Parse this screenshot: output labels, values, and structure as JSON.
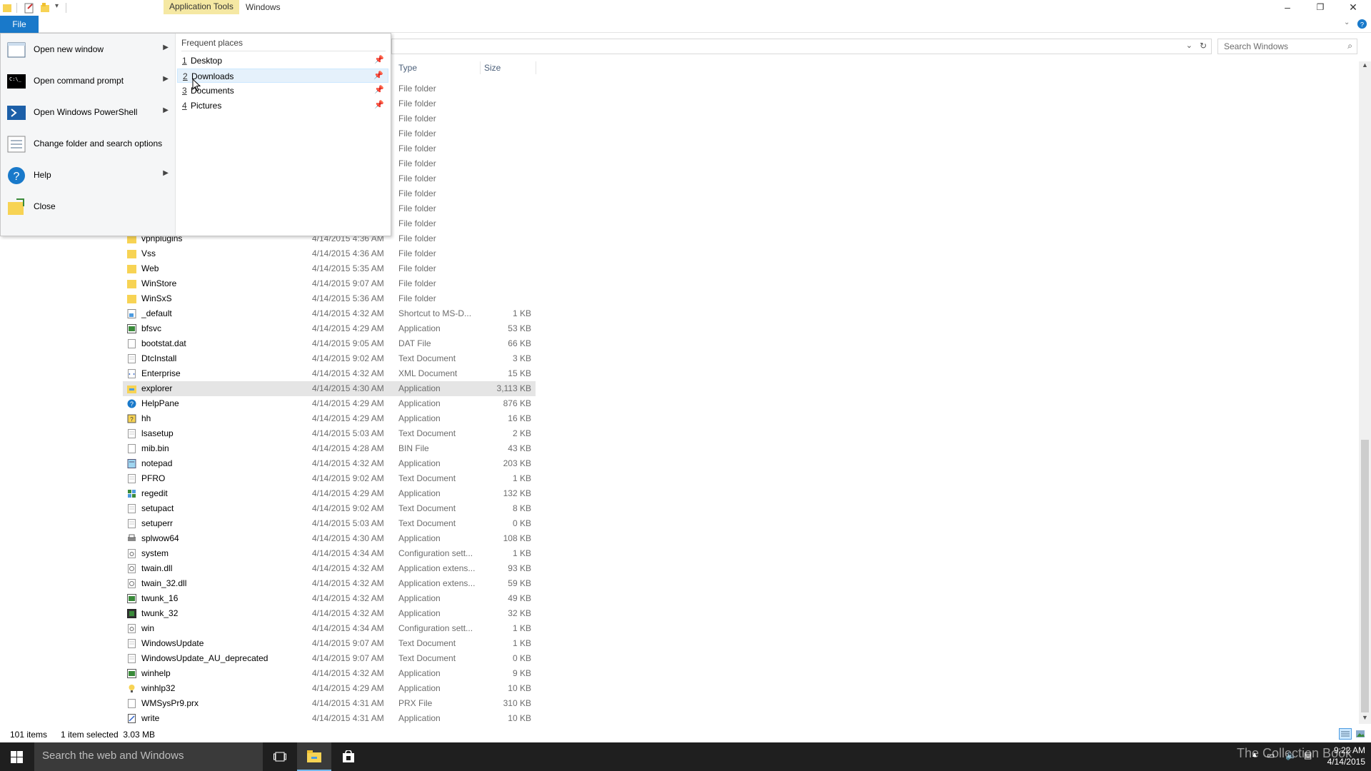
{
  "titlebar": {
    "contextual_tab": "Application Tools",
    "window_title": "Windows",
    "minimize_glyph": "–",
    "restore_glyph": "❐",
    "close_glyph": "✕"
  },
  "ribbon": {
    "file_tab": "File"
  },
  "search": {
    "placeholder": "Search Windows"
  },
  "columns": {
    "type": "Type",
    "size": "Size"
  },
  "file_menu": {
    "items": [
      {
        "label": "Open new window",
        "has_submenu": true,
        "icon": "new-window-icon"
      },
      {
        "label": "Open command prompt",
        "has_submenu": true,
        "icon": "command-prompt-icon"
      },
      {
        "label": "Open Windows PowerShell",
        "has_submenu": true,
        "icon": "powershell-icon"
      },
      {
        "label": "Change folder and search options",
        "has_submenu": false,
        "icon": "folder-options-icon"
      },
      {
        "label": "Help",
        "has_submenu": true,
        "icon": "help-icon"
      },
      {
        "label": "Close",
        "has_submenu": false,
        "icon": "close-folder-icon"
      }
    ],
    "frequent_title": "Frequent places",
    "frequent": [
      {
        "num": "1",
        "name": "Desktop"
      },
      {
        "num": "2",
        "name": "Downloads"
      },
      {
        "num": "3",
        "name": "Documents"
      },
      {
        "num": "4",
        "name": "Pictures"
      }
    ]
  },
  "files": [
    {
      "name": "",
      "date": "",
      "type": "File folder",
      "size": "",
      "icon": "folder"
    },
    {
      "name": "",
      "date": "",
      "type": "File folder",
      "size": "",
      "icon": "folder"
    },
    {
      "name": "",
      "date": "",
      "type": "File folder",
      "size": "",
      "icon": "folder"
    },
    {
      "name": "",
      "date": "",
      "type": "File folder",
      "size": "",
      "icon": "folder"
    },
    {
      "name": "",
      "date": "",
      "type": "File folder",
      "size": "",
      "icon": "folder"
    },
    {
      "name": "",
      "date": "",
      "type": "File folder",
      "size": "",
      "icon": "folder"
    },
    {
      "name": "",
      "date": "",
      "type": "File folder",
      "size": "",
      "icon": "folder"
    },
    {
      "name": "",
      "date": "",
      "type": "File folder",
      "size": "",
      "icon": "folder"
    },
    {
      "name": "",
      "date": "",
      "type": "File folder",
      "size": "",
      "icon": "folder"
    },
    {
      "name": "",
      "date": "",
      "type": "File folder",
      "size": "",
      "icon": "folder"
    },
    {
      "name": "vpnplugins",
      "date": "4/14/2015 4:36 AM",
      "type": "File folder",
      "size": "",
      "icon": "folder"
    },
    {
      "name": "Vss",
      "date": "4/14/2015 4:36 AM",
      "type": "File folder",
      "size": "",
      "icon": "folder"
    },
    {
      "name": "Web",
      "date": "4/14/2015 5:35 AM",
      "type": "File folder",
      "size": "",
      "icon": "folder"
    },
    {
      "name": "WinStore",
      "date": "4/14/2015 9:07 AM",
      "type": "File folder",
      "size": "",
      "icon": "folder"
    },
    {
      "name": "WinSxS",
      "date": "4/14/2015 5:36 AM",
      "type": "File folder",
      "size": "",
      "icon": "folder"
    },
    {
      "name": "_default",
      "date": "4/14/2015 4:32 AM",
      "type": "Shortcut to MS-D...",
      "size": "1 KB",
      "icon": "shortcut"
    },
    {
      "name": "bfsvc",
      "date": "4/14/2015 4:29 AM",
      "type": "Application",
      "size": "53 KB",
      "icon": "app"
    },
    {
      "name": "bootstat.dat",
      "date": "4/14/2015 9:05 AM",
      "type": "DAT File",
      "size": "66 KB",
      "icon": "file"
    },
    {
      "name": "DtcInstall",
      "date": "4/14/2015 9:02 AM",
      "type": "Text Document",
      "size": "3 KB",
      "icon": "text"
    },
    {
      "name": "Enterprise",
      "date": "4/14/2015 4:32 AM",
      "type": "XML Document",
      "size": "15 KB",
      "icon": "xml"
    },
    {
      "name": "explorer",
      "date": "4/14/2015 4:30 AM",
      "type": "Application",
      "size": "3,113 KB",
      "icon": "explorer",
      "selected": true
    },
    {
      "name": "HelpPane",
      "date": "4/14/2015 4:29 AM",
      "type": "Application",
      "size": "876 KB",
      "icon": "help"
    },
    {
      "name": "hh",
      "date": "4/14/2015 4:29 AM",
      "type": "Application",
      "size": "16 KB",
      "icon": "hh"
    },
    {
      "name": "lsasetup",
      "date": "4/14/2015 5:03 AM",
      "type": "Text Document",
      "size": "2 KB",
      "icon": "text"
    },
    {
      "name": "mib.bin",
      "date": "4/14/2015 4:28 AM",
      "type": "BIN File",
      "size": "43 KB",
      "icon": "file"
    },
    {
      "name": "notepad",
      "date": "4/14/2015 4:32 AM",
      "type": "Application",
      "size": "203 KB",
      "icon": "notepad"
    },
    {
      "name": "PFRO",
      "date": "4/14/2015 9:02 AM",
      "type": "Text Document",
      "size": "1 KB",
      "icon": "text"
    },
    {
      "name": "regedit",
      "date": "4/14/2015 4:29 AM",
      "type": "Application",
      "size": "132 KB",
      "icon": "regedit"
    },
    {
      "name": "setupact",
      "date": "4/14/2015 9:02 AM",
      "type": "Text Document",
      "size": "8 KB",
      "icon": "text"
    },
    {
      "name": "setuperr",
      "date": "4/14/2015 5:03 AM",
      "type": "Text Document",
      "size": "0 KB",
      "icon": "text"
    },
    {
      "name": "splwow64",
      "date": "4/14/2015 4:30 AM",
      "type": "Application",
      "size": "108 KB",
      "icon": "printer"
    },
    {
      "name": "system",
      "date": "4/14/2015 4:34 AM",
      "type": "Configuration sett...",
      "size": "1 KB",
      "icon": "config"
    },
    {
      "name": "twain.dll",
      "date": "4/14/2015 4:32 AM",
      "type": "Application extens...",
      "size": "93 KB",
      "icon": "dll"
    },
    {
      "name": "twain_32.dll",
      "date": "4/14/2015 4:32 AM",
      "type": "Application extens...",
      "size": "59 KB",
      "icon": "dll"
    },
    {
      "name": "twunk_16",
      "date": "4/14/2015 4:32 AM",
      "type": "Application",
      "size": "49 KB",
      "icon": "app"
    },
    {
      "name": "twunk_32",
      "date": "4/14/2015 4:32 AM",
      "type": "Application",
      "size": "32 KB",
      "icon": "app-dark"
    },
    {
      "name": "win",
      "date": "4/14/2015 4:34 AM",
      "type": "Configuration sett...",
      "size": "1 KB",
      "icon": "config"
    },
    {
      "name": "WindowsUpdate",
      "date": "4/14/2015 9:07 AM",
      "type": "Text Document",
      "size": "1 KB",
      "icon": "text"
    },
    {
      "name": "WindowsUpdate_AU_deprecated",
      "date": "4/14/2015 9:07 AM",
      "type": "Text Document",
      "size": "0 KB",
      "icon": "text"
    },
    {
      "name": "winhelp",
      "date": "4/14/2015 4:32 AM",
      "type": "Application",
      "size": "9 KB",
      "icon": "app"
    },
    {
      "name": "winhlp32",
      "date": "4/14/2015 4:29 AM",
      "type": "Application",
      "size": "10 KB",
      "icon": "winhlp"
    },
    {
      "name": "WMSysPr9.prx",
      "date": "4/14/2015 4:31 AM",
      "type": "PRX File",
      "size": "310 KB",
      "icon": "file"
    },
    {
      "name": "write",
      "date": "4/14/2015 4:31 AM",
      "type": "Application",
      "size": "10 KB",
      "icon": "write"
    }
  ],
  "status": {
    "item_count": "101 items",
    "selection": "1 item selected  3.03 MB"
  },
  "taskbar": {
    "search_placeholder": "Search the web and Windows",
    "time": "9:22 AM",
    "date": "4/14/2015",
    "watermark": "The Collection Book"
  },
  "colors": {
    "file_tab": "#1979ca",
    "context_tab": "#f5e8a3",
    "folder": "#f7d354",
    "taskbar": "#1f1f1f"
  }
}
